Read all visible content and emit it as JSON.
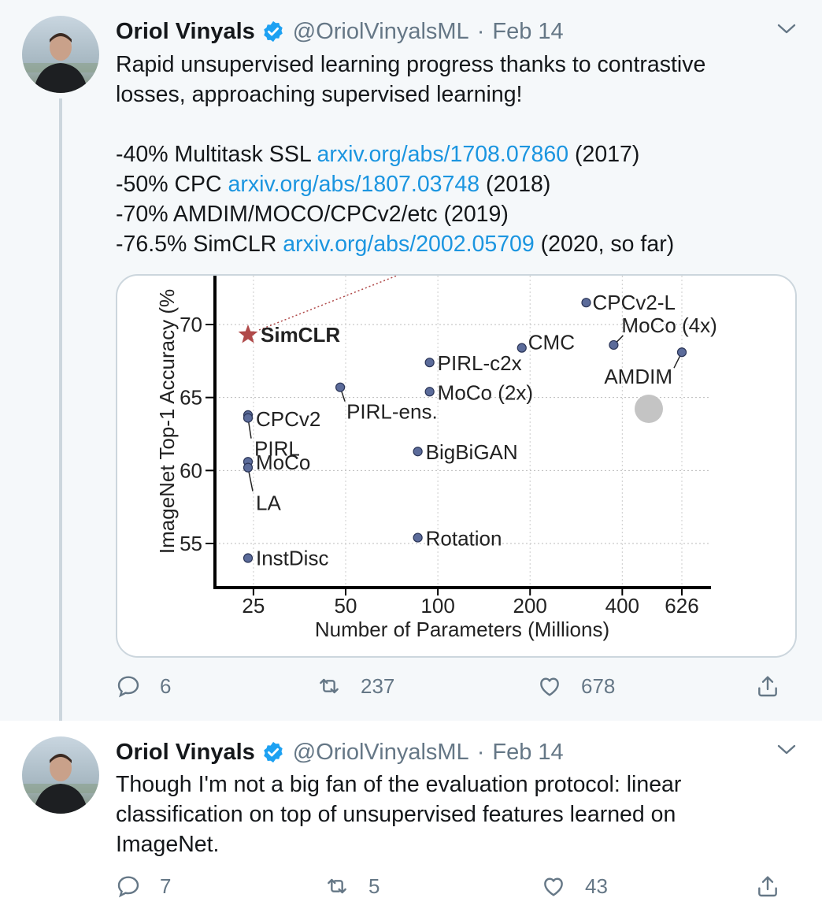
{
  "tweets": [
    {
      "author_name": "Oriol Vinyals",
      "handle": "@OriolVinyalsML",
      "separator": "·",
      "date": "Feb 14",
      "lines": [
        {
          "text": "Rapid unsupervised learning progress thanks to contrastive"
        },
        {
          "text": "losses, approaching supervised learning!"
        },
        {
          "text": ""
        },
        {
          "pre": "-40% Multitask SSL ",
          "link": "arxiv.org/abs/1708.07860",
          "post": " (2017)"
        },
        {
          "pre": "-50% CPC ",
          "link": "arxiv.org/abs/1807.03748",
          "post": " (2018)"
        },
        {
          "text": "-70% AMDIM/MOCO/CPCv2/etc (2019)"
        },
        {
          "pre": "-76.5% SimCLR ",
          "link": "arxiv.org/abs/2002.05709",
          "post": " (2020, so far)"
        }
      ],
      "replies": "6",
      "retweets": "237",
      "likes": "678"
    },
    {
      "author_name": "Oriol Vinyals",
      "handle": "@OriolVinyalsML",
      "separator": "·",
      "date": "Feb 14",
      "lines": [
        {
          "text": "Though I'm not a big fan of the evaluation protocol: linear"
        },
        {
          "text": "classification on top of unsupervised features learned on"
        },
        {
          "text": "ImageNet."
        }
      ],
      "replies": "7",
      "retweets": "5",
      "likes": "43"
    }
  ],
  "icons": {
    "verified": "verified-badge-icon",
    "more": "chevron-down-icon",
    "reply": "reply-icon",
    "retweet": "retweet-icon",
    "like": "heart-icon",
    "share": "share-icon"
  },
  "colors": {
    "link": "#1b95e0",
    "muted": "#657786",
    "verified": "#1da1f2",
    "highlight_bg": "#f5f8fa",
    "point": "#5b6b9a",
    "star": "#b04a4a"
  },
  "chart_data": {
    "type": "scatter",
    "xlabel": "Number of Parameters (Millions)",
    "ylabel": "ImageNet Top-1 Accuracy (%",
    "x_ticks": [
      "25",
      "50",
      "100",
      "200",
      "400",
      "626"
    ],
    "y_ticks": [
      "55",
      "60",
      "65",
      "70"
    ],
    "x_scale": "log",
    "ylim": [
      52,
      75
    ],
    "points": [
      {
        "label": "SimCLR",
        "x": 24,
        "y": 69.3,
        "marker": "star"
      },
      {
        "label": "CPCv2",
        "x": 24,
        "y": 63.8
      },
      {
        "label": "PIRL",
        "x": 24,
        "y": 63.6
      },
      {
        "label": "MoCo",
        "x": 24,
        "y": 60.6
      },
      {
        "label": "LA",
        "x": 24,
        "y": 60.2
      },
      {
        "label": "InstDisc",
        "x": 24,
        "y": 54.0
      },
      {
        "label": "PIRL-ens.",
        "x": 48,
        "y": 65.7
      },
      {
        "label": "PIRL-c2x",
        "x": 94,
        "y": 67.4
      },
      {
        "label": "MoCo (2x)",
        "x": 94,
        "y": 65.4
      },
      {
        "label": "BigBiGAN",
        "x": 86,
        "y": 61.3
      },
      {
        "label": "Rotation",
        "x": 86,
        "y": 55.4
      },
      {
        "label": "CMC",
        "x": 188,
        "y": 68.4
      },
      {
        "label": "CPCv2-L",
        "x": 305,
        "y": 71.5
      },
      {
        "label": "MoCo (4x)",
        "x": 375,
        "y": 68.6
      },
      {
        "label": "AMDIM",
        "x": 626,
        "y": 68.1
      }
    ]
  }
}
